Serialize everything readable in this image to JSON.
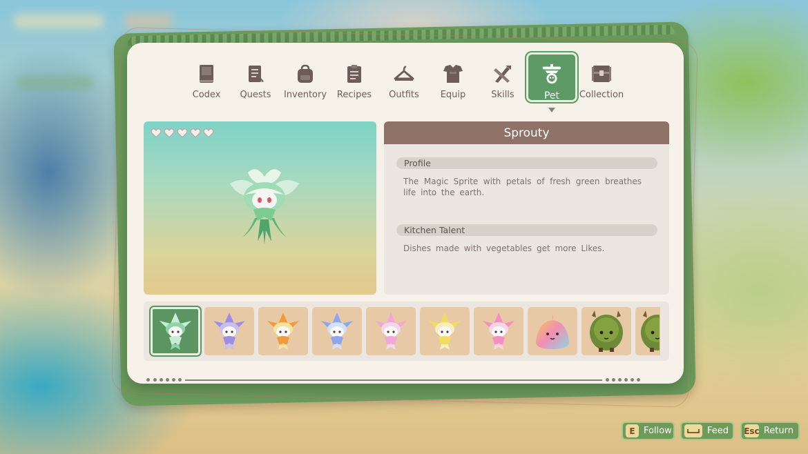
{
  "tabs": [
    {
      "label": "Codex",
      "icon": "book-icon"
    },
    {
      "label": "Quests",
      "icon": "scroll-icon"
    },
    {
      "label": "Inventory",
      "icon": "backpack-icon"
    },
    {
      "label": "Recipes",
      "icon": "clipboard-icon"
    },
    {
      "label": "Outfits",
      "icon": "hanger-icon"
    },
    {
      "label": "Equip",
      "icon": "armor-icon"
    },
    {
      "label": "Skills",
      "icon": "tools-icon"
    },
    {
      "label": "Pet",
      "icon": "pet-bowl-icon",
      "active": true
    },
    {
      "label": "Collection",
      "icon": "chest-icon"
    }
  ],
  "pet": {
    "name": "Sprouty",
    "hearts_filled": 5,
    "hearts_total": 5,
    "profile_heading": "Profile",
    "profile_text": "The Magic Sprite with petals of fresh green breathes life into the earth.",
    "talent_heading": "Kitchen Talent",
    "talent_text": "Dishes made with vegetables get more Likes."
  },
  "pet_list": [
    {
      "kind": "sprite",
      "petal": "#c9ecd5",
      "body": "#8fd3a8",
      "selected": true
    },
    {
      "kind": "sprite",
      "petal": "#9c8ee6",
      "body": "#c7bff2"
    },
    {
      "kind": "sprite",
      "petal": "#f29a3c",
      "body": "#f5e3a0"
    },
    {
      "kind": "sprite",
      "petal": "#8da7ee",
      "body": "#d3e0f7"
    },
    {
      "kind": "sprite",
      "petal": "#f0a6d8",
      "body": "#f3d6ec"
    },
    {
      "kind": "sprite",
      "petal": "#f2dd5c",
      "body": "#f7eeb9"
    },
    {
      "kind": "sprite",
      "petal": "#f48fc0",
      "body": "#f8d5e6"
    },
    {
      "kind": "slime",
      "colors": [
        "#f5d048",
        "#f28fb0",
        "#8fd4e8"
      ]
    },
    {
      "kind": "bush",
      "color": "#6d8a36"
    },
    {
      "kind": "bush-partial",
      "color": "#6d8a36"
    }
  ],
  "hints": [
    {
      "key": "E",
      "label": "Follow"
    },
    {
      "key": "␣",
      "label": "Feed"
    },
    {
      "key": "Esc",
      "label": "Return"
    }
  ],
  "colors": {
    "accent_green": "#5d9a66",
    "title_bar": "#8e7267",
    "panel_bg": "#f6f2ea"
  }
}
